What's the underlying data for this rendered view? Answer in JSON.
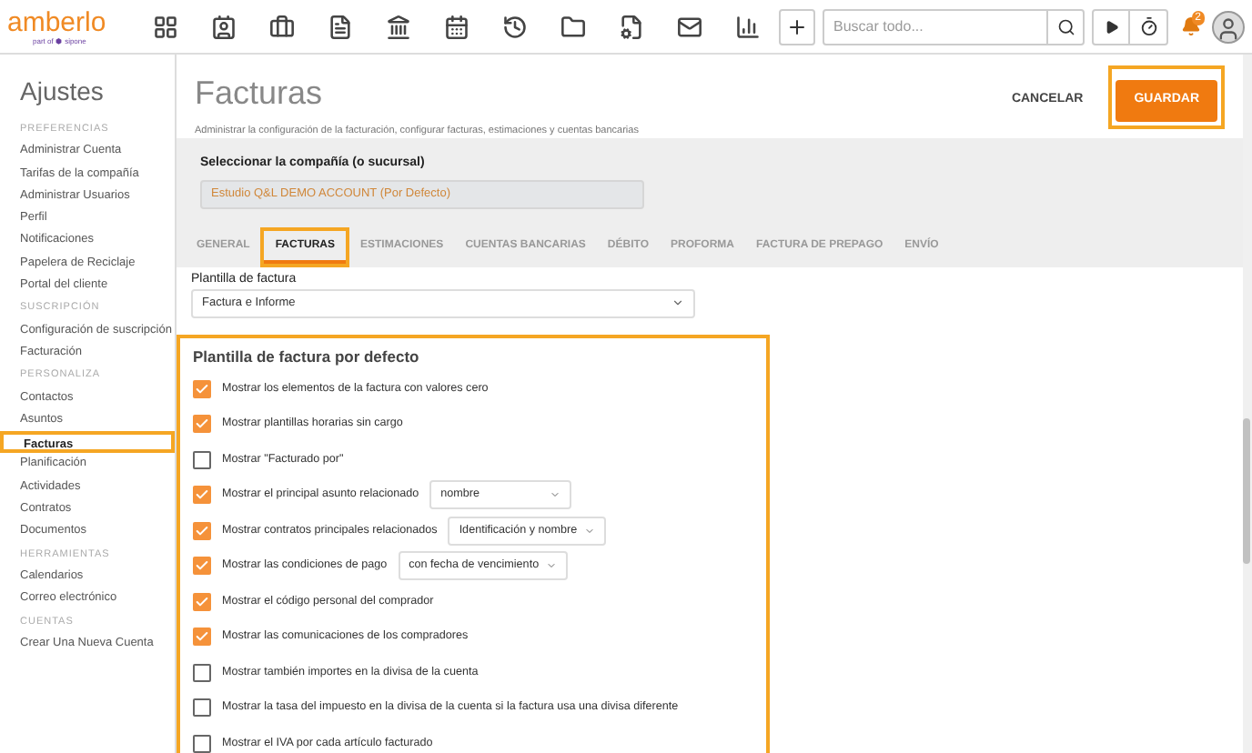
{
  "topbar": {
    "logo": "amberlo",
    "logo_sub": "part of ⬢ sipone",
    "search": {
      "placeholder": "Buscar todo..."
    },
    "notifications": "2"
  },
  "sidebar": {
    "title": "Ajustes",
    "groups": [
      {
        "heading": "PREFERENCIAS",
        "items": [
          {
            "label": "Administrar Cuenta",
            "selected": false
          },
          {
            "label": "Tarifas de la compañía",
            "selected": false
          },
          {
            "label": "Administrar Usuarios",
            "selected": false
          },
          {
            "label": "Perfil",
            "selected": false
          },
          {
            "label": "Notificaciones",
            "selected": false
          },
          {
            "label": "Papelera de Reciclaje",
            "selected": false
          },
          {
            "label": "Portal del cliente",
            "selected": false
          }
        ]
      },
      {
        "heading": "SUSCRIPCIÓN",
        "items": [
          {
            "label": "Configuración de suscripción",
            "selected": false
          },
          {
            "label": "Facturación",
            "selected": false
          }
        ]
      },
      {
        "heading": "PERSONALIZA",
        "items": [
          {
            "label": "Contactos",
            "selected": false
          },
          {
            "label": "Asuntos",
            "selected": false
          },
          {
            "label": "Facturas",
            "selected": true
          },
          {
            "label": "Planificación",
            "selected": false
          },
          {
            "label": "Actividades",
            "selected": false
          },
          {
            "label": "Contratos",
            "selected": false
          },
          {
            "label": "Documentos",
            "selected": false
          }
        ]
      },
      {
        "heading": "HERRAMIENTAS",
        "items": [
          {
            "label": "Calendarios",
            "selected": false
          },
          {
            "label": "Correo electrónico",
            "selected": false
          }
        ]
      },
      {
        "heading": "CUENTAS",
        "items": [
          {
            "label": "Crear Una Nueva Cuenta",
            "selected": false
          }
        ]
      }
    ]
  },
  "header": {
    "title": "Facturas",
    "subtitle": "Administrar la configuración de la facturación, configurar facturas, estimaciones y cuentas bancarias",
    "cancel": "CANCELAR",
    "save": "GUARDAR"
  },
  "company": {
    "label": "Seleccionar la compañía (o sucursal)",
    "value": "Estudio Q&L DEMO ACCOUNT (Por Defecto)"
  },
  "tabs": [
    {
      "label": "GENERAL",
      "selected": false
    },
    {
      "label": "FACTURAS",
      "selected": true
    },
    {
      "label": "ESTIMACIONES",
      "selected": false
    },
    {
      "label": "CUENTAS BANCARIAS",
      "selected": false
    },
    {
      "label": "DÉBITO",
      "selected": false
    },
    {
      "label": "PROFORMA",
      "selected": false
    },
    {
      "label": "FACTURA DE PREPAGO",
      "selected": false
    },
    {
      "label": "ENVÍO",
      "selected": false
    }
  ],
  "template": {
    "label": "Plantilla de factura",
    "value": "Factura e Informe"
  },
  "defaults": {
    "title": "Plantilla de factura por defecto",
    "options": [
      {
        "label": "Mostrar los elementos de la factura con valores cero",
        "checked": true
      },
      {
        "label": "Mostrar plantillas horarias sin cargo",
        "checked": true
      },
      {
        "label": "Mostrar \"Facturado por\"",
        "checked": false
      },
      {
        "label": "Mostrar el principal asunto relacionado",
        "checked": true,
        "select": "nombre"
      },
      {
        "label": "Mostrar contratos principales relacionados",
        "checked": true,
        "select": "Identificación y nombre"
      },
      {
        "label": "Mostrar las condiciones de pago",
        "checked": true,
        "select": "con fecha de vencimiento"
      },
      {
        "label": "Mostrar el código personal del comprador",
        "checked": true
      },
      {
        "label": "Mostrar las comunicaciones de los compradores",
        "checked": true
      },
      {
        "label": "Mostrar también importes en la divisa de la cuenta",
        "checked": false
      },
      {
        "label": "Mostrar la tasa del impuesto en la divisa de la cuenta si la factura usa una divisa diferente",
        "checked": false
      },
      {
        "label": "Mostrar el IVA por cada artículo facturado",
        "checked": false
      }
    ]
  }
}
